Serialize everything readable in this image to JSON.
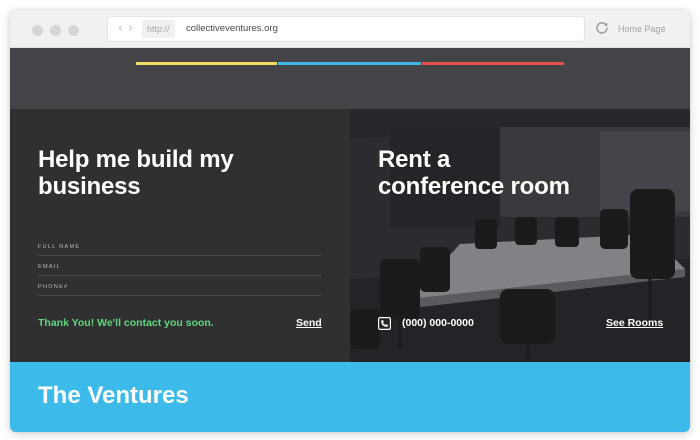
{
  "browser": {
    "protocol": "http://",
    "url": "collectiveventures.org",
    "home_label": "Home Page",
    "back_icon": "chevron-left-icon",
    "forward_icon": "chevron-right-icon",
    "reload_icon": "reload-icon"
  },
  "colors": {
    "stripe_yellow": "#f4dc5e",
    "stripe_blue": "#3fb8e8",
    "stripe_red": "#e8524a",
    "success_green": "#5fd87c",
    "ventures_bg": "#3cbaea"
  },
  "contact": {
    "title": "Help me build my business",
    "fields": [
      {
        "label": "FULL NAME",
        "value": ""
      },
      {
        "label": "EMAIL",
        "value": ""
      },
      {
        "label": "PHONE#",
        "value": ""
      }
    ],
    "success_message": "Thank You! We'll contact you soon.",
    "send_label": "Send"
  },
  "rent": {
    "title": "Rent a conference room",
    "phone": "(000) 000-0000",
    "phone_icon": "phone-icon",
    "cta_label": "See Rooms"
  },
  "ventures": {
    "title": "The Ventures"
  }
}
